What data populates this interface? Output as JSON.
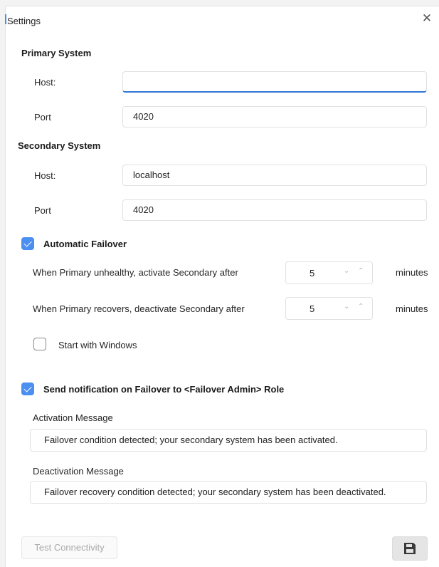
{
  "window": {
    "title": "Settings",
    "close_glyph": "✕"
  },
  "primary": {
    "heading": "Primary System",
    "host_label": "Host:",
    "host_value": "",
    "port_label": "Port",
    "port_value": "4020"
  },
  "secondary": {
    "heading": "Secondary System",
    "host_label": "Host:",
    "host_value": "localhost",
    "port_label": "Port",
    "port_value": "4020"
  },
  "failover": {
    "checked": true,
    "label": "Automatic Failover",
    "activate_label": "When Primary unhealthy, activate Secondary after",
    "activate_value": "5",
    "deactivate_label": "When Primary recovers, deactivate Secondary after",
    "deactivate_value": "5",
    "unit": "minutes",
    "spinner_down_glyph": "⌄",
    "spinner_up_glyph": "⌃"
  },
  "startup": {
    "checked": false,
    "label": "Start with Windows"
  },
  "notification": {
    "checked": true,
    "label": "Send notification on Failover to <Failover Admin> Role",
    "activation_label": "Activation Message",
    "activation_message": "Failover condition detected; your secondary system has been activated.",
    "deactivation_label": "Deactivation Message",
    "deactivation_message": "Failover recovery condition detected; your secondary system has been deactivated."
  },
  "footer": {
    "test_label": "Test Connectivity",
    "save_icon": "floppy-disk-icon"
  },
  "colors": {
    "accent": "#4b8ff0",
    "focus": "#2f78d4",
    "disabled_text": "#a9a9a9"
  }
}
